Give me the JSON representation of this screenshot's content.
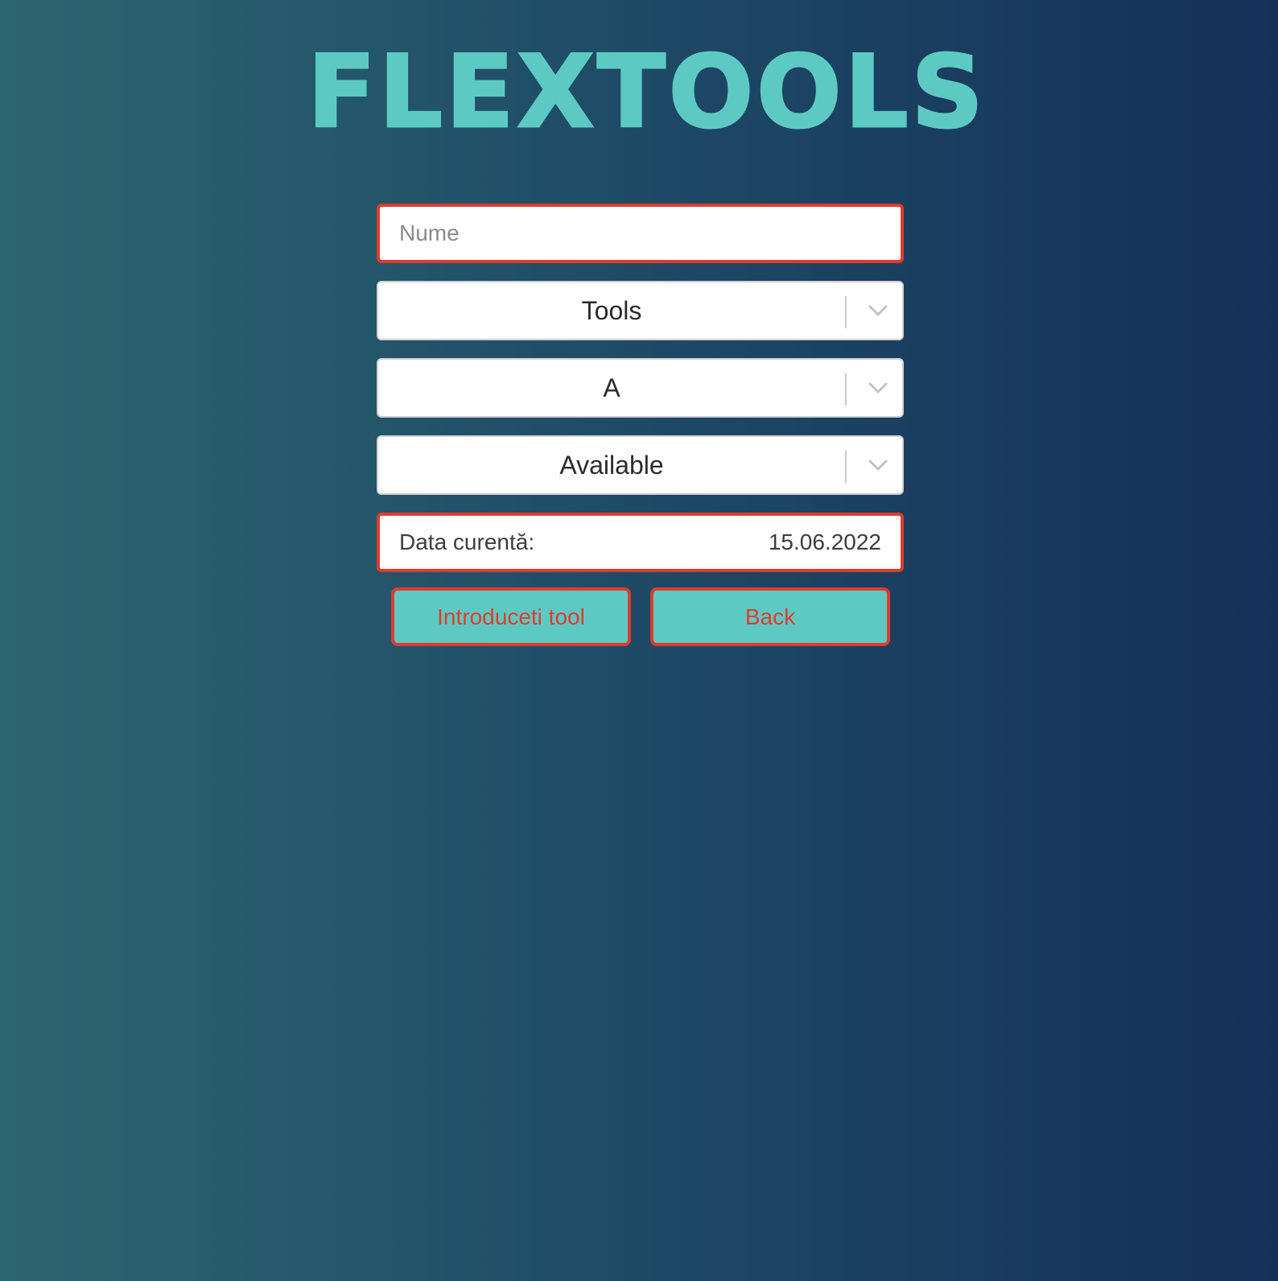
{
  "app": {
    "logo_text": "FLEXTOOLS"
  },
  "form": {
    "name_input": {
      "placeholder": "Nume",
      "value": ""
    },
    "category_select": {
      "value": "Tools"
    },
    "type_select": {
      "value": "A"
    },
    "status_select": {
      "value": "Available"
    },
    "date": {
      "label": "Data curentă:",
      "value": "15.06.2022"
    }
  },
  "buttons": {
    "submit_label": "Introduceti tool",
    "back_label": "Back"
  },
  "colors": {
    "accent": "#5ccac3",
    "error": "#e03b2e",
    "background_start": "#2c6670",
    "background_end": "#152f59"
  },
  "icons": {
    "dropdown": "chevron-down-icon"
  }
}
